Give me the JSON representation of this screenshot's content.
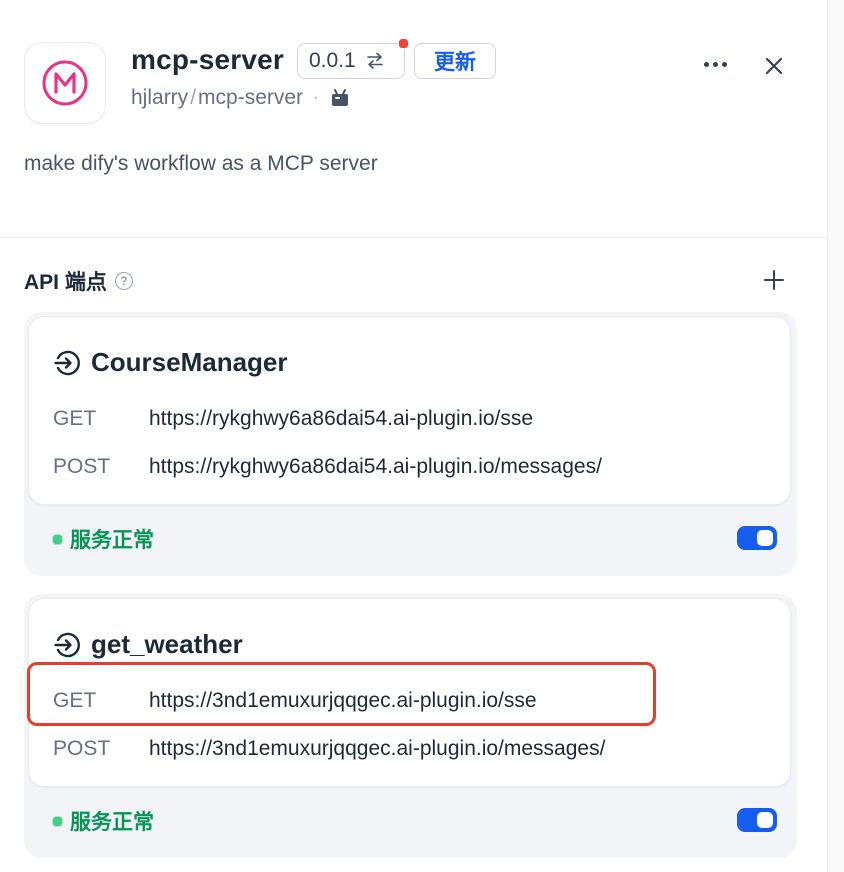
{
  "header": {
    "plugin_name": "mcp-server",
    "version": "0.0.1",
    "update_label": "更新",
    "author": "hjlarry",
    "separator": "/",
    "repo": "mcp-server",
    "logo_letter": "M"
  },
  "description": "make dify's workflow as a MCP server",
  "endpoints_section": {
    "title": "API 端点",
    "help": "?"
  },
  "endpoints": [
    {
      "name": "CourseManager",
      "urls": [
        {
          "method": "GET",
          "url": "https://rykghwy6a86dai54.ai-plugin.io/sse"
        },
        {
          "method": "POST",
          "url": "https://rykghwy6a86dai54.ai-plugin.io/messages/"
        }
      ],
      "status": "服务正常",
      "enabled": true
    },
    {
      "name": "get_weather",
      "urls": [
        {
          "method": "GET",
          "url": "https://3nd1emuxurjqqgec.ai-plugin.io/sse"
        },
        {
          "method": "POST",
          "url": "https://3nd1emuxurjqqgec.ai-plugin.io/messages/"
        }
      ],
      "status": "服务正常",
      "enabled": true
    }
  ],
  "colors": {
    "brand_pink": "#e8338b",
    "accent_blue": "#155eef",
    "status_green": "#079455",
    "highlight_red": "#e53e2a"
  }
}
